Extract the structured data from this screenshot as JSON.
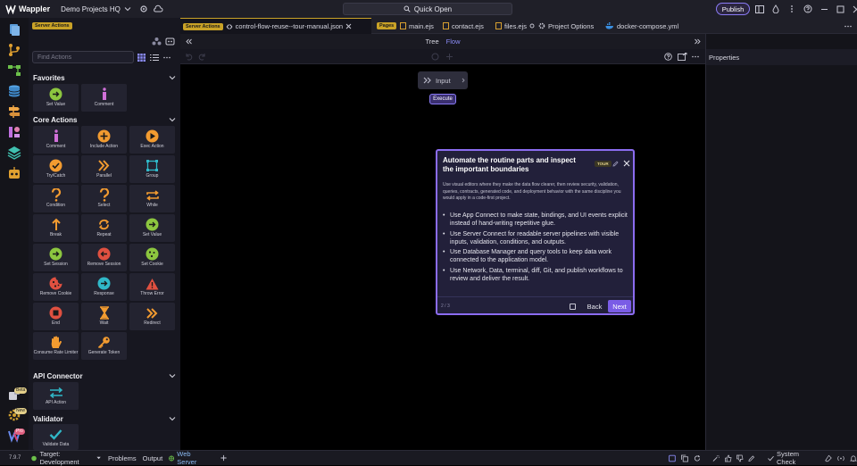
{
  "app": {
    "name": "Wappler",
    "project": "Demo Projects HQ",
    "quick_open": "Quick Open",
    "publish": "Publish"
  },
  "left_panel": {
    "context_badge": "Server Actions",
    "search_placeholder": "Find Actions",
    "sections": {
      "favorites": "Favorites",
      "core": "Core Actions",
      "api": "API Connector",
      "validator": "Validator"
    },
    "favorites": [
      "Set Value",
      "Comment"
    ],
    "core": [
      "Comment",
      "Include Action",
      "Exec Action",
      "Try/Catch",
      "Parallel",
      "Group",
      "Condition",
      "Select",
      "While",
      "Break",
      "Repeat",
      "Set Value",
      "Set Session",
      "Remove Session",
      "Set Cookie",
      "Remove Cookie",
      "Response",
      "Throw Error",
      "End",
      "Wait",
      "Redirect",
      "Consume Rate Limiter",
      "Generate Token"
    ],
    "api": [
      "API Action"
    ],
    "validator": [
      "Validate Data"
    ]
  },
  "activity_badges": {
    "beta": "Beta",
    "new": "New",
    "pro": "Pro"
  },
  "tabs": {
    "active": "control-flow-reuse--tour-manual.json",
    "pages_badge": "Pages",
    "main": "main.ejs",
    "contact": "contact.ejs",
    "files": "files.ejs",
    "options": "Project Options",
    "docker": "docker-compose.yml"
  },
  "editor": {
    "tree": "Tree",
    "flow": "Flow",
    "node_label": "Input",
    "execute": "Execute"
  },
  "tour": {
    "title": "Automate the routine parts and inspect the important boundaries",
    "badge": "TOUR",
    "description": "Use visual editors where they make the data flow clearer, then review security, validation, queries, contracts, generated code, and deployment behavior with the same discipline you would apply in a code-first project.",
    "bullets": [
      "Use App Connect to make state, bindings, and UI events explicit instead of hand-writing repetitive glue.",
      "Use Server Connect for readable server pipelines with visible inputs, validation, conditions, and outputs.",
      "Use Database Manager and query tools to keep data work connected to the application model.",
      "Use Network, Data, terminal, diff, Git, and publish workflows to review and deliver the result."
    ],
    "step": "2 / 3",
    "back": "Back",
    "next": "Next"
  },
  "properties": {
    "title": "Properties"
  },
  "status": {
    "version": "7.9.7",
    "target": "Target: Development",
    "problems": "Problems",
    "output": "Output",
    "web_server": "Web Server",
    "system_check": "System Check"
  },
  "colors": {
    "accent": "#8b6cf0",
    "gold": "#c9a227",
    "green": "#6cc04a",
    "orange": "#f0a030",
    "red": "#e05040",
    "teal": "#30b0c0"
  }
}
